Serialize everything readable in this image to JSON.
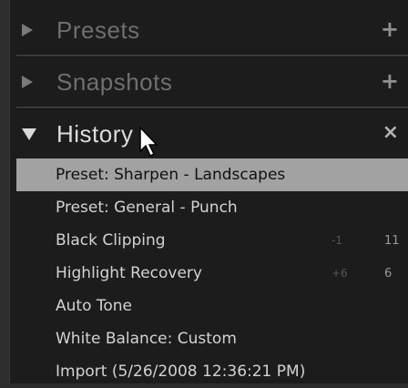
{
  "sections": [
    {
      "title": "Presets",
      "action": "+"
    },
    {
      "title": "Snapshots",
      "action": "+"
    },
    {
      "title": "History",
      "action": "×"
    }
  ],
  "history": [
    {
      "label": "Preset: Sharpen - Landscapes",
      "val1": "",
      "val2": "",
      "selected": true
    },
    {
      "label": "Preset: General - Punch",
      "val1": "",
      "val2": ""
    },
    {
      "label": "Black Clipping",
      "val1": "-1",
      "val2": "11"
    },
    {
      "label": "Highlight Recovery",
      "val1": "+6",
      "val2": "6"
    },
    {
      "label": "Auto Tone",
      "val1": "",
      "val2": ""
    },
    {
      "label": "White Balance: Custom",
      "val1": "",
      "val2": ""
    },
    {
      "label": "Import (5/26/2008 12:36:21 PM)",
      "val1": "",
      "val2": ""
    }
  ]
}
